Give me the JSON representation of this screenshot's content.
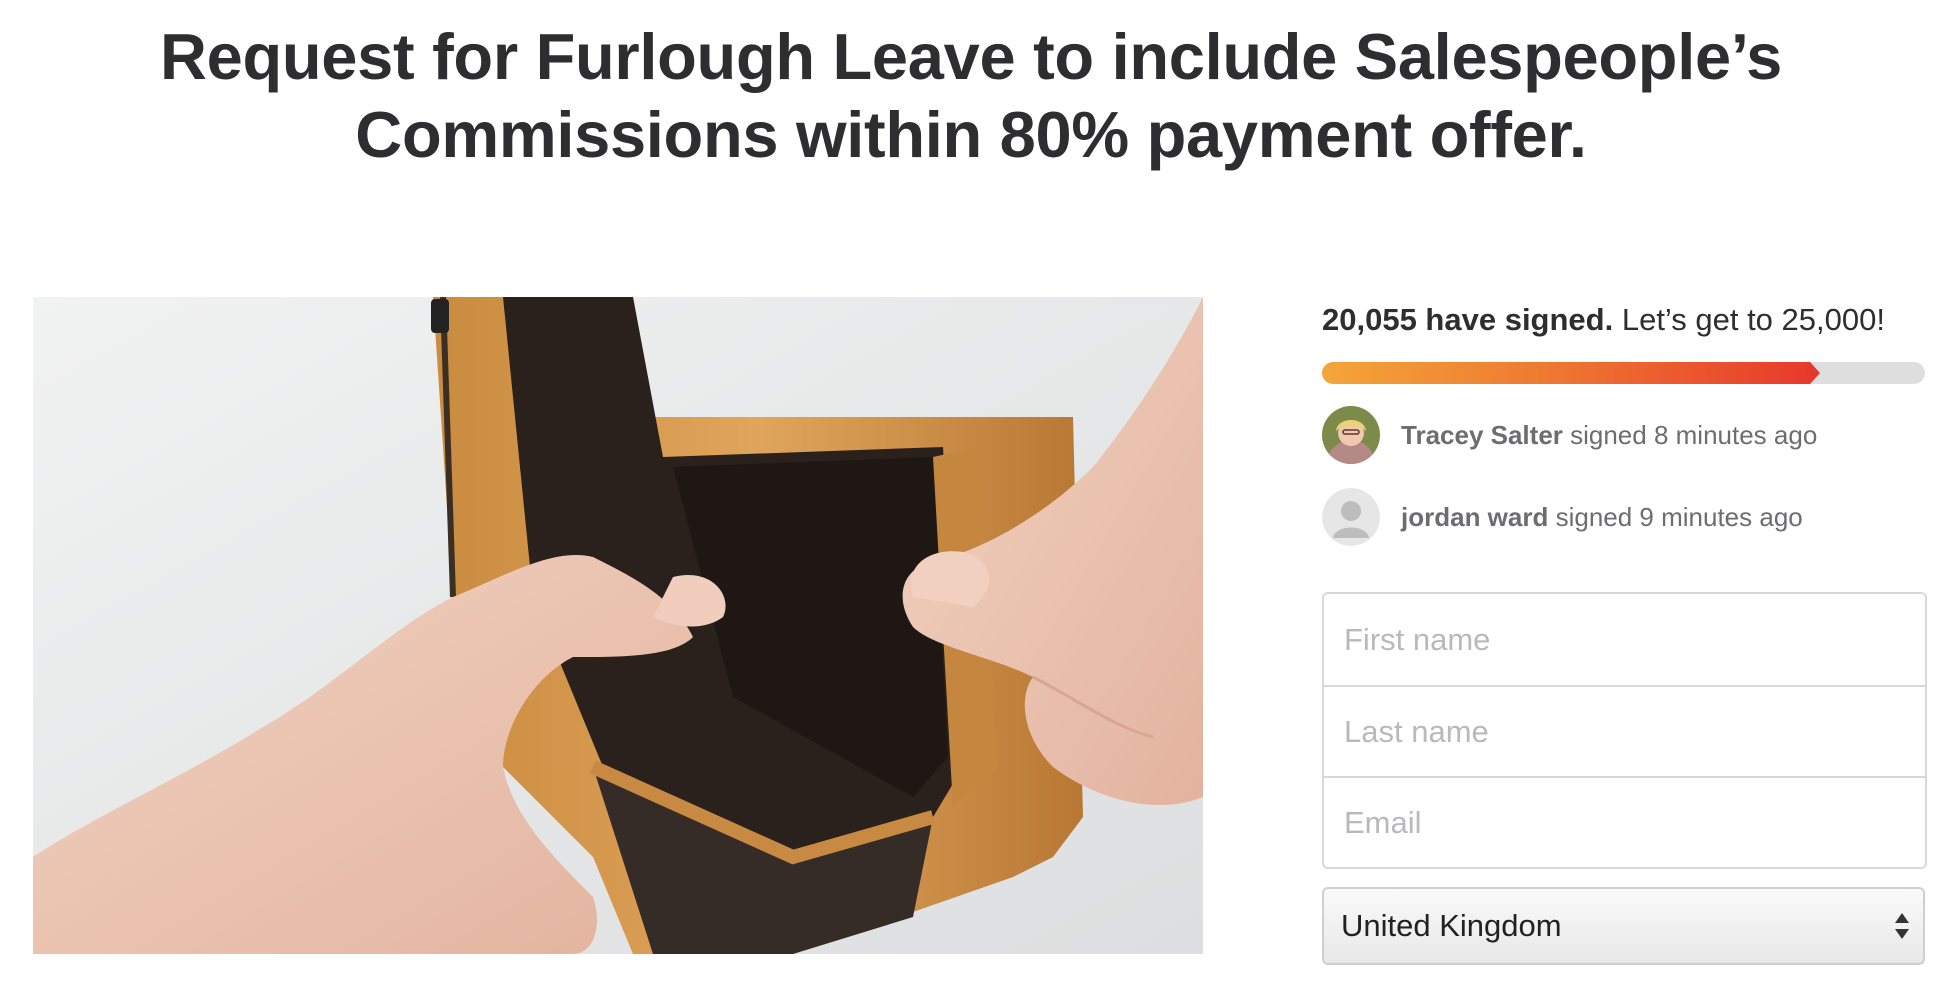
{
  "petition": {
    "title_line1": "Request for Furlough Leave to include Salespeople’s",
    "title_line2": "Commissions within 80% payment offer."
  },
  "hero_image": {
    "alt": "empty-wallet-photo"
  },
  "progress": {
    "signed_text": "20,055 have signed.",
    "goal_text": " Let’s get to 25,000!",
    "signed": 20055,
    "goal": 25000,
    "fill_fraction": 0.81,
    "gradient_start": "#f4a53a",
    "gradient_end": "#e83a2c"
  },
  "recent_signers": [
    {
      "name": "Tracey Salter",
      "action": " signed 8 minutes ago",
      "avatar": "photo"
    },
    {
      "name": "jordan ward",
      "action": " signed 9 minutes ago",
      "avatar": "placeholder"
    }
  ],
  "form": {
    "first_name_placeholder": "First name",
    "last_name_placeholder": "Last name",
    "email_placeholder": "Email",
    "country_value": "United Kingdom"
  }
}
